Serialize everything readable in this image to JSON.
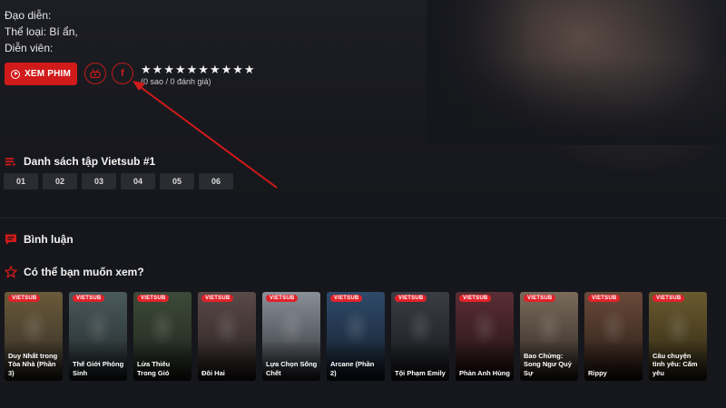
{
  "movie": {
    "director_label": "Đạo diễn:",
    "genre_label": "Thể loại: Bí ẩn,",
    "cast_label": "Diễn viên:"
  },
  "actions": {
    "watch_label": "XEM PHIM",
    "youtube_icon": "youtube-icon",
    "facebook_icon": "facebook-icon",
    "facebook_glyph": "f"
  },
  "rating": {
    "stars": 10,
    "text": "(0 sao / 0 đánh giá)"
  },
  "episodes": {
    "title": "Danh sách tập Vietsub #1",
    "items": [
      "01",
      "02",
      "03",
      "04",
      "05",
      "06"
    ]
  },
  "comments": {
    "title": "Bình luận"
  },
  "suggestions": {
    "title": "Có thể bạn muốn xem?",
    "badge": "VIETSUB",
    "items": [
      {
        "title": "Duy Nhất trong Tòa Nhà (Phần 3)"
      },
      {
        "title": "Thế Giới Phóng Sinh"
      },
      {
        "title": "Lửa Thiêu Trong Gió"
      },
      {
        "title": "Đôi Hai"
      },
      {
        "title": "Lựa Chọn Sống Chết"
      },
      {
        "title": "Arcane (Phần 2)"
      },
      {
        "title": "Tội Phạm Emily"
      },
      {
        "title": "Phản Anh Hùng"
      },
      {
        "title": "Bao Chửng: Song Ngư Quỷ Sự"
      },
      {
        "title": "Rippy"
      },
      {
        "title": "Câu chuyện tình yêu: Cấm yêu"
      }
    ]
  },
  "colors": {
    "accent": "#d11a1a",
    "background": "#16171c",
    "episode_bg": "#2b2c31",
    "annotation_arrow": "#d11a1a"
  }
}
